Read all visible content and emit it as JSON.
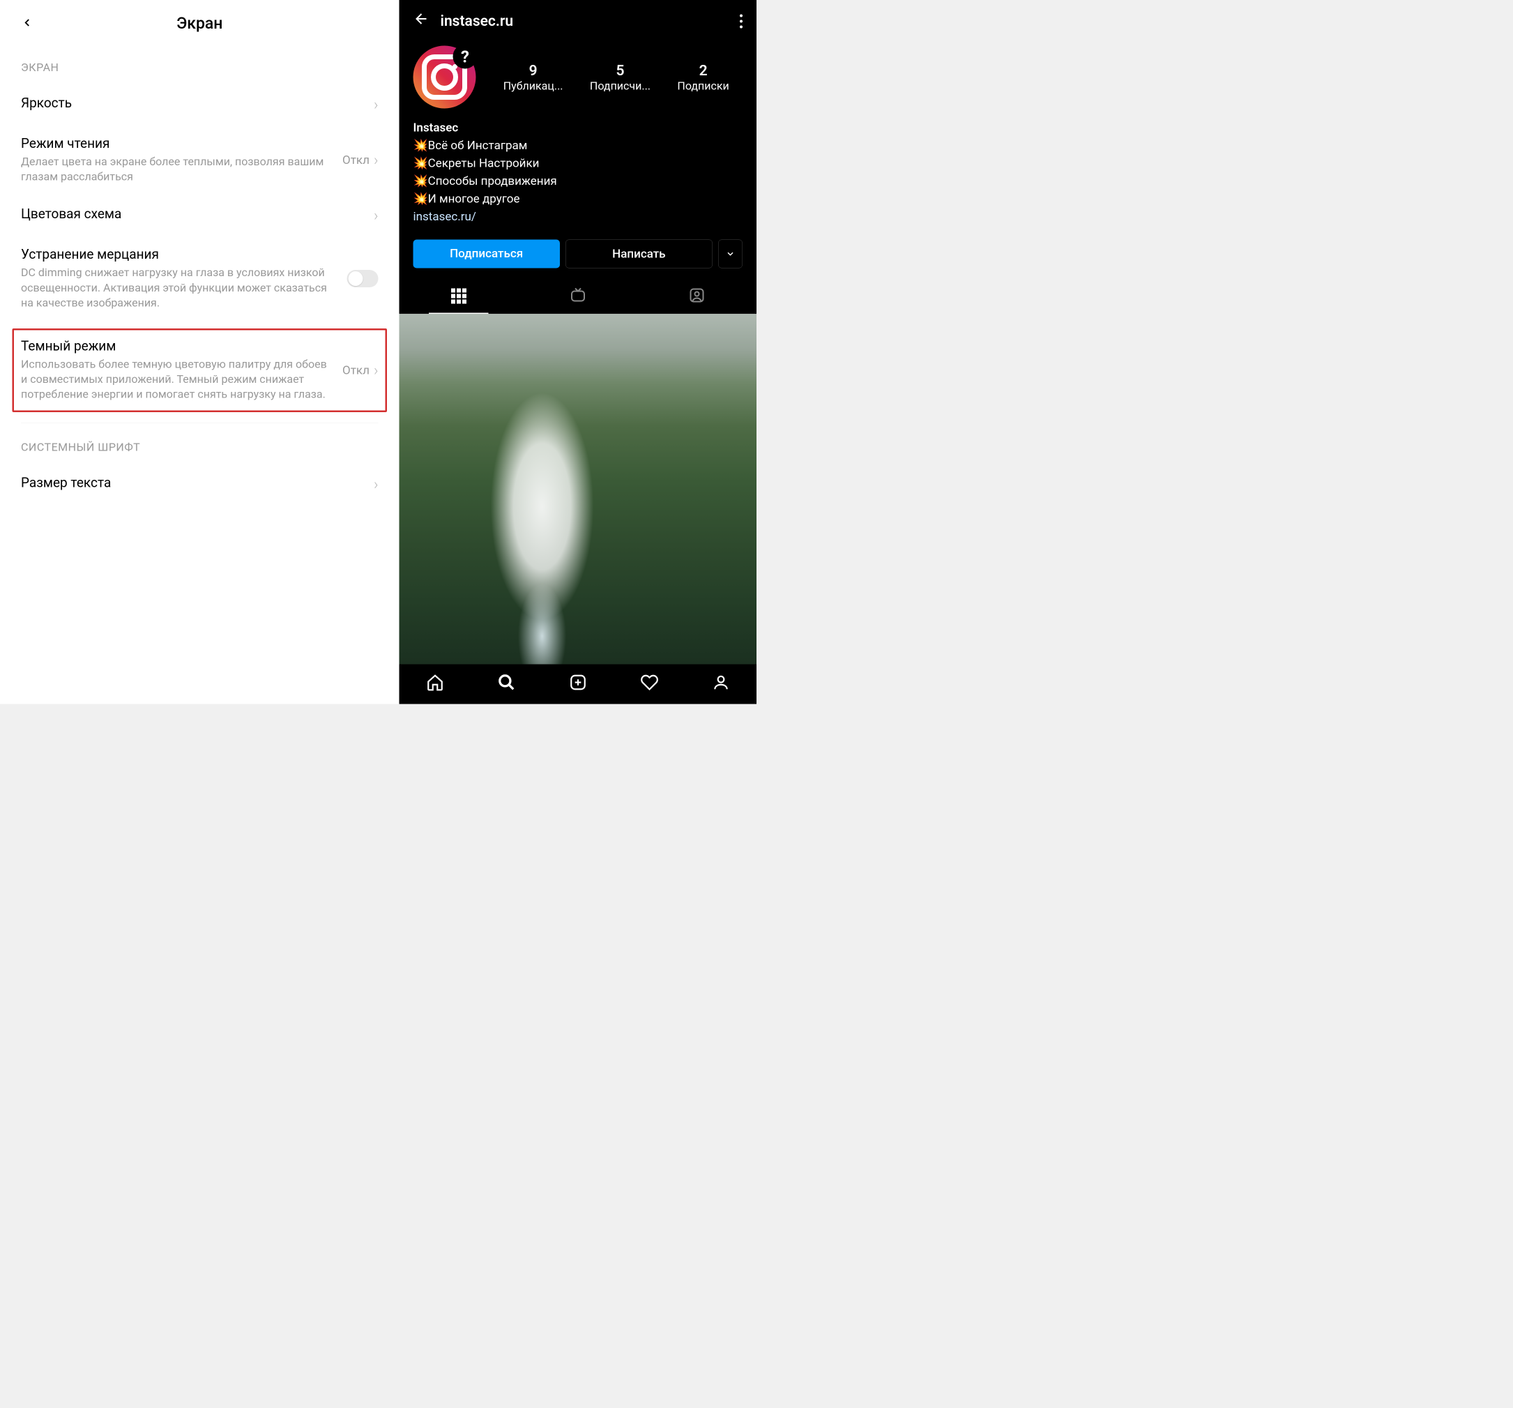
{
  "left": {
    "title": "Экран",
    "sections": {
      "screen_header": "ЭКРАН",
      "font_header": "СИСТЕМНЫЙ ШРИФТ"
    },
    "brightness": {
      "title": "Яркость"
    },
    "reading": {
      "title": "Режим чтения",
      "desc": "Делает цвета на экране более теплыми, позволяя вашим глазам расслабиться",
      "value": "Откл"
    },
    "color_scheme": {
      "title": "Цветовая схема"
    },
    "flicker": {
      "title": "Устранение мерцания",
      "desc": "DC dimming снижает нагрузку на глаза в условиях низкой освещенности. Активация этой функции может сказаться на качестве изображения."
    },
    "dark_mode": {
      "title": "Темный режим",
      "desc": "Использовать более темную цветовую палитру для обоев и совместимых приложений. Темный режим снижает потребление энергии и помогает снять нагрузку на глаза.",
      "value": "Откл"
    },
    "text_size": {
      "title": "Размер текста"
    }
  },
  "right": {
    "username": "instasec.ru",
    "badge": "?",
    "stats": {
      "posts": {
        "count": "9",
        "label": "Публикац..."
      },
      "followers": {
        "count": "5",
        "label": "Подписчи..."
      },
      "following": {
        "count": "2",
        "label": "Подписки"
      }
    },
    "bio": {
      "name": "Instasec",
      "lines": [
        "💥Всё об Инстаграм",
        "💥Секреты Настройки",
        "💥Способы продвижения",
        "💥И многое другое"
      ],
      "link": "instasec.ru/"
    },
    "buttons": {
      "follow": "Подписаться",
      "message": "Написать"
    }
  }
}
